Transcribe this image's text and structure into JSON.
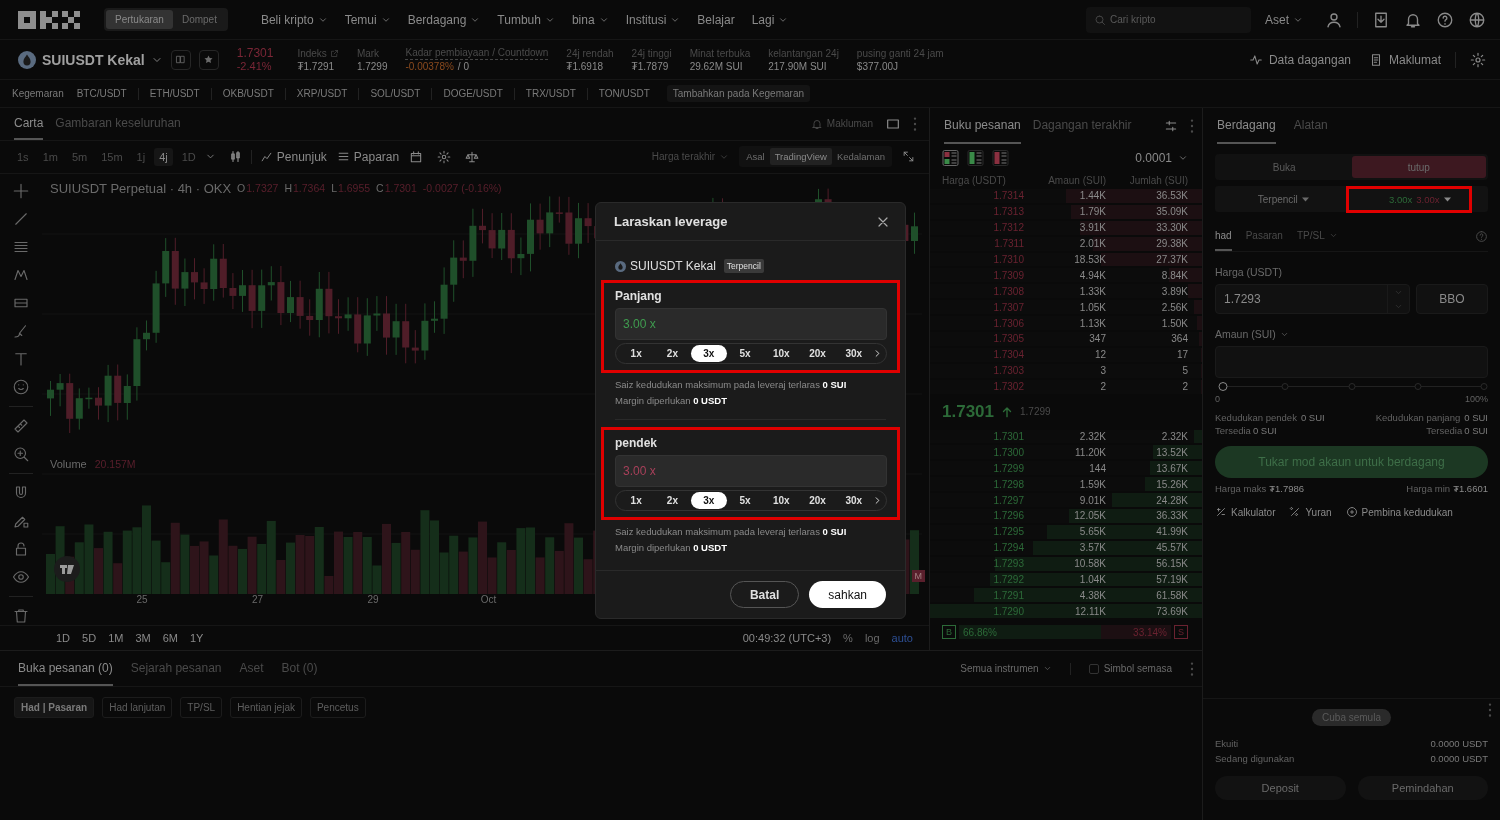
{
  "header": {
    "modes": [
      {
        "label": "Pertukaran",
        "selected": true
      },
      {
        "label": "Dompet",
        "selected": false
      }
    ],
    "nav": [
      {
        "label": "Beli kripto",
        "dropdown": true
      },
      {
        "label": "Temui",
        "dropdown": true
      },
      {
        "label": "Berdagang",
        "dropdown": true
      },
      {
        "label": "Tumbuh",
        "dropdown": true
      },
      {
        "label": "bina",
        "dropdown": true
      },
      {
        "label": "Institusi",
        "dropdown": true
      },
      {
        "label": "Belajar",
        "dropdown": false
      },
      {
        "label": "Lagi",
        "dropdown": true
      }
    ],
    "search": {
      "placeholder": "Cari kripto"
    },
    "assets": "Aset"
  },
  "ticker": {
    "symbol": "SUIUSDT Kekal",
    "price": "1.7301",
    "change": "-2.41%",
    "stats": [
      {
        "label": "Indeks",
        "kind": "link",
        "value": "₮1.7291"
      },
      {
        "label": "Mark",
        "kind": "plain",
        "value": "1.7299"
      },
      {
        "label": "Kadar pembiayaan / Countdown",
        "kind": "funding",
        "value": "-0.00378%",
        "suffix": "/ 0"
      },
      {
        "label": "24j rendah",
        "kind": "plain",
        "value": "₮1.6918"
      },
      {
        "label": "24j tinggi",
        "kind": "plain",
        "value": "₮1.7879"
      },
      {
        "label": "Minat terbuka",
        "kind": "plain",
        "value": "29.62M SUI"
      },
      {
        "label": "kelantangan 24j",
        "kind": "plain",
        "value": "217.90M SUI"
      },
      {
        "label": "pusing ganti 24 jam",
        "kind": "plain",
        "value": "$377.00J"
      }
    ],
    "actions": [
      {
        "label": "Data dagangan",
        "kind": "chart"
      },
      {
        "label": "Maklumat",
        "kind": "info"
      }
    ]
  },
  "favorites": {
    "label": "Kegemaran",
    "pairs": [
      "BTC/USDT",
      "ETH/USDT",
      "OKB/USDT",
      "XRP/USDT",
      "SOL/USDT",
      "DOGE/USDT",
      "TRX/USDT",
      "TON/USDT"
    ],
    "add": "Tambahkan pada Kegemaran"
  },
  "chart": {
    "tabs": [
      {
        "label": "Carta",
        "selected": true
      },
      {
        "label": "Gambaran keseluruhan",
        "selected": false
      }
    ],
    "alert": "Makluman",
    "intervals": [
      {
        "label": "1s",
        "selected": false
      },
      {
        "label": "1m",
        "selected": false
      },
      {
        "label": "5m",
        "selected": false
      },
      {
        "label": "15m",
        "selected": false
      },
      {
        "label": "1j",
        "selected": false
      },
      {
        "label": "4j",
        "selected": true
      },
      {
        "label": "1D",
        "selected": false
      }
    ],
    "tools": [
      {
        "label": "Penunjuk",
        "kind": "indicator"
      },
      {
        "label": "Paparan",
        "kind": "display"
      }
    ],
    "price_source": "Harga terakhir",
    "views": [
      {
        "label": "Asal",
        "selected": false
      },
      {
        "label": "TradingView",
        "selected": true
      },
      {
        "label": "Kedalaman",
        "selected": false
      }
    ],
    "legend": {
      "title": "SUIUSDT Perpetual · 4h · OKX",
      "ohlc": [
        {
          "key": "O",
          "value": "1.7327"
        },
        {
          "key": "H",
          "value": "1.7364"
        },
        {
          "key": "L",
          "value": "1.6955"
        },
        {
          "key": "C",
          "value": "1.7301"
        }
      ],
      "change": "-0.0027 (-0.16%)"
    },
    "volume": {
      "label": "Volume",
      "value": "20.157M"
    },
    "axis_tag": "M",
    "x_labels": [
      "25",
      "27",
      "29",
      "Oct"
    ],
    "ranges": [
      "1D",
      "5D",
      "1M",
      "3M",
      "6M",
      "1Y"
    ],
    "time": "00:49:32 (UTC+3)",
    "scale": [
      {
        "label": "%",
        "selected": false
      },
      {
        "label": "log",
        "selected": false
      },
      {
        "label": "auto",
        "selected": true
      }
    ]
  },
  "order_book": {
    "tabs": [
      {
        "label": "Buku pesanan",
        "selected": true
      },
      {
        "label": "Dagangan terakhir",
        "selected": false
      }
    ],
    "views": [
      {
        "kind": "both",
        "selected": true
      },
      {
        "kind": "bids",
        "selected": false
      },
      {
        "kind": "asks",
        "selected": false
      }
    ],
    "precision": "0.0001",
    "columns": [
      "Harga (USDT)",
      "Amaun (SUI)",
      "Jumlah (SUI)"
    ],
    "asks": [
      {
        "price": "1.7314",
        "amount": "1.44K",
        "total": "36.53K",
        "level": 0.5
      },
      {
        "price": "1.7313",
        "amount": "1.79K",
        "total": "35.09K",
        "level": 0.48
      },
      {
        "price": "1.7312",
        "amount": "3.91K",
        "total": "33.30K",
        "level": 0.45
      },
      {
        "price": "1.7311",
        "amount": "2.01K",
        "total": "29.38K",
        "level": 0.4
      },
      {
        "price": "1.7310",
        "amount": "18.53K",
        "total": "27.37K",
        "level": 0.37
      },
      {
        "price": "1.7309",
        "amount": "4.94K",
        "total": "8.84K",
        "level": 0.12
      },
      {
        "price": "1.7308",
        "amount": "1.33K",
        "total": "3.89K",
        "level": 0.05
      },
      {
        "price": "1.7307",
        "amount": "1.05K",
        "total": "2.56K",
        "level": 0.03
      },
      {
        "price": "1.7306",
        "amount": "1.13K",
        "total": "1.50K",
        "level": 0.02
      },
      {
        "price": "1.7305",
        "amount": "347",
        "total": "364",
        "level": 0.01
      },
      {
        "price": "1.7304",
        "amount": "12",
        "total": "17",
        "level": 0
      },
      {
        "price": "1.7303",
        "amount": "3",
        "total": "5",
        "level": 0
      },
      {
        "price": "1.7302",
        "amount": "2",
        "total": "2",
        "level": 0
      }
    ],
    "last_price": "1.7301",
    "mark_price": "1.7299",
    "bids": [
      {
        "price": "1.7301",
        "amount": "2.32K",
        "total": "2.32K",
        "level": 0.03
      },
      {
        "price": "1.7300",
        "amount": "11.20K",
        "total": "13.52K",
        "level": 0.18
      },
      {
        "price": "1.7299",
        "amount": "144",
        "total": "13.67K",
        "level": 0.19
      },
      {
        "price": "1.7298",
        "amount": "1.59K",
        "total": "15.26K",
        "level": 0.21
      },
      {
        "price": "1.7297",
        "amount": "9.01K",
        "total": "24.28K",
        "level": 0.33
      },
      {
        "price": "1.7296",
        "amount": "12.05K",
        "total": "36.33K",
        "level": 0.49
      },
      {
        "price": "1.7295",
        "amount": "5.65K",
        "total": "41.99K",
        "level": 0.57
      },
      {
        "price": "1.7294",
        "amount": "3.57K",
        "total": "45.57K",
        "level": 0.62
      },
      {
        "price": "1.7293",
        "amount": "10.58K",
        "total": "56.15K",
        "level": 0.76
      },
      {
        "price": "1.7292",
        "amount": "1.04K",
        "total": "57.19K",
        "level": 0.78
      },
      {
        "price": "1.7291",
        "amount": "4.38K",
        "total": "61.58K",
        "level": 0.84
      },
      {
        "price": "1.7290",
        "amount": "12.11K",
        "total": "73.69K",
        "level": 1
      }
    ],
    "ratio": {
      "buy_tag": "B",
      "buy": "66.86%",
      "sell": "33.14%",
      "sell_tag": "S",
      "level": 0.67
    }
  },
  "trade": {
    "tabs": [
      {
        "label": "Berdagang",
        "selected": true
      },
      {
        "label": "Alatan",
        "selected": false
      }
    ],
    "sides": [
      {
        "label": "Buka",
        "selected": false
      },
      {
        "label": "tutup",
        "selected": true
      }
    ],
    "margin_mode": "Terpencil",
    "leverage": {
      "long": "3.00x",
      "short": "3.00x"
    },
    "order_types": [
      {
        "label": "had",
        "selected": true,
        "dropdown": false
      },
      {
        "label": "Pasaran",
        "selected": false,
        "dropdown": false
      },
      {
        "label": "TP/SL",
        "selected": false,
        "dropdown": true
      }
    ],
    "price": {
      "label": "Harga (USDT)",
      "value": "1.7293",
      "bbo": "BBO"
    },
    "amount": {
      "label": "Amaun (SUI)"
    },
    "slider": {
      "level": 0,
      "min": "0",
      "max": "100%"
    },
    "positions": [
      {
        "label": "Kedudukan pendek",
        "value": "0 SUI",
        "avail_label": "Tersedia",
        "avail": "0 SUI"
      },
      {
        "label": "Kedudukan panjang",
        "value": "0 SUI",
        "avail_label": "Tersedia",
        "avail": "0 SUI"
      }
    ],
    "submit": "Tukar mod akaun untuk berdagang",
    "limits": [
      {
        "label": "Harga maks",
        "value": "₮1.7986"
      },
      {
        "label": "Harga min",
        "value": "₮1.6601"
      }
    ],
    "tools": [
      {
        "label": "Kalkulator",
        "kind": "calculator"
      },
      {
        "label": "Yuran",
        "kind": "fee"
      },
      {
        "label": "Pembina kedudukan",
        "kind": "builder"
      }
    ]
  },
  "account": {
    "retry": "Cuba semula",
    "rows": [
      {
        "label": "Ekuiti",
        "value": "0.0000 USDT"
      },
      {
        "label": "Sedang digunakan",
        "value": "0.0000 USDT"
      }
    ],
    "buttons": [
      "Deposit",
      "Pemindahan"
    ]
  },
  "orders": {
    "tabs": [
      {
        "label": "Buka pesanan (0)",
        "selected": true
      },
      {
        "label": "Sejarah pesanan",
        "selected": false
      },
      {
        "label": "Aset",
        "selected": false
      },
      {
        "label": "Bot (0)",
        "selected": false
      }
    ],
    "filter": "Semua instrumen",
    "current_symbol": {
      "label": "Simbol semasa",
      "checked": false
    },
    "subtabs": [
      {
        "label": "Had | Pasaran",
        "selected": true
      },
      {
        "label": "Had lanjutan",
        "selected": false
      },
      {
        "label": "TP/SL",
        "selected": false
      },
      {
        "label": "Hentian jejak",
        "selected": false
      },
      {
        "label": "Pencetus",
        "selected": false
      }
    ]
  },
  "modal": {
    "title": "Laraskan leverage",
    "symbol": "SUIUSDT Kekal",
    "badge": "Terpencil",
    "sections": [
      {
        "kind": "long",
        "label": "Panjang",
        "value": "3.00 x",
        "options": [
          {
            "label": "1x",
            "selected": false
          },
          {
            "label": "2x",
            "selected": false
          },
          {
            "label": "3x",
            "selected": true
          },
          {
            "label": "5x",
            "selected": false
          },
          {
            "label": "10x",
            "selected": false
          },
          {
            "label": "20x",
            "selected": false
          },
          {
            "label": "30x",
            "selected": false
          }
        ],
        "info": [
          "Saiz kedudukan maksimum pada leveraj terlaras **0 SUI**",
          "Margin diperlukan **0 USDT**"
        ]
      },
      {
        "kind": "short",
        "label": "pendek",
        "value": "3.00 x",
        "options": [
          {
            "label": "1x",
            "selected": false
          },
          {
            "label": "2x",
            "selected": false
          },
          {
            "label": "3x",
            "selected": true
          },
          {
            "label": "5x",
            "selected": false
          },
          {
            "label": "10x",
            "selected": false
          },
          {
            "label": "20x",
            "selected": false
          },
          {
            "label": "30x",
            "selected": false
          }
        ],
        "info": [
          "Saiz kedudukan maksimum pada leveraj terlaras **0 SUI**",
          "Margin diperlukan **0 USDT**"
        ]
      }
    ],
    "cancel": "Batal",
    "confirm": "sahkan"
  }
}
